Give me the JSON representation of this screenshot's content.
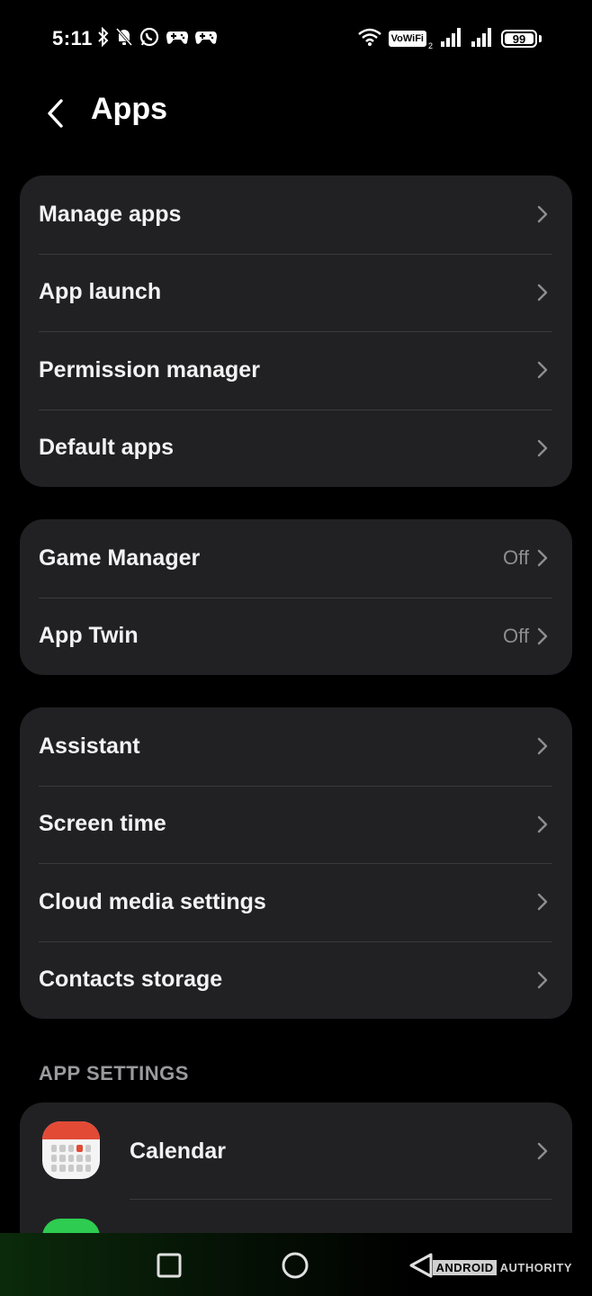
{
  "status_bar": {
    "time": "5:11",
    "vowifi": "VoWiFi",
    "vowifi_sub": "2",
    "battery": "99",
    "left_icons": [
      "bluetooth-icon",
      "bell-off-icon",
      "whatsapp-icon",
      "game-controller-icon",
      "game-controller-icon"
    ],
    "right_icons": [
      "wifi-icon",
      "signal-icon",
      "signal-icon",
      "battery-icon"
    ]
  },
  "header": {
    "title": "Apps"
  },
  "group1": {
    "items": [
      {
        "label": "Manage apps"
      },
      {
        "label": "App launch"
      },
      {
        "label": "Permission manager"
      },
      {
        "label": "Default apps"
      }
    ]
  },
  "group2": {
    "items": [
      {
        "label": "Game Manager",
        "value": "Off"
      },
      {
        "label": "App Twin",
        "value": "Off"
      }
    ]
  },
  "group3": {
    "items": [
      {
        "label": "Assistant"
      },
      {
        "label": "Screen time"
      },
      {
        "label": "Cloud media settings"
      },
      {
        "label": "Contacts storage"
      }
    ]
  },
  "app_settings": {
    "section_title": "APP SETTINGS",
    "items": [
      {
        "label": "Calendar",
        "icon": "calendar-icon"
      }
    ]
  },
  "watermark": {
    "brand_box": "ANDROID",
    "brand_rest": "AUTHORITY"
  },
  "colors": {
    "background": "#000000",
    "card": "#212124",
    "text": "#f2f2f2",
    "secondary_text": "#8e8e92",
    "calendar_accent": "#e24a36"
  }
}
